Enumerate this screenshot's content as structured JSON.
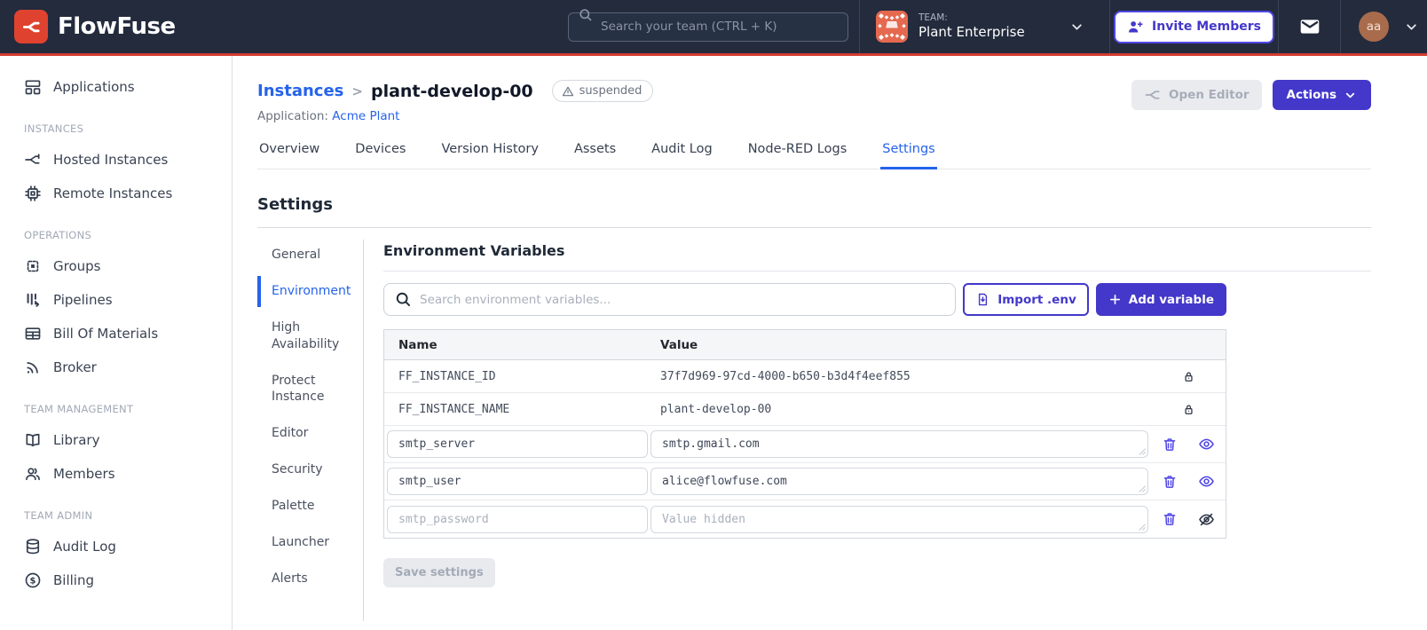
{
  "colors": {
    "navbar_bg": "#232B3D",
    "brand_red": "#DF432F",
    "red_accent_line": "#D23B31",
    "accent_indigo": "#4338CA",
    "link_blue": "#2563EB",
    "user_avatar_brown": "#A86B4C",
    "team_avatar_orange": "#E5694F"
  },
  "navbar": {
    "brand": "FlowFuse",
    "search_placeholder": "Search your team (CTRL + K)",
    "team_label": "TEAM:",
    "team_name": "Plant Enterprise",
    "invite_button": "Invite Members",
    "avatar_initials": "aa"
  },
  "sidebar": {
    "sections": [
      {
        "label": "",
        "items": [
          {
            "icon": "applications-icon",
            "label": "Applications"
          }
        ]
      },
      {
        "label": "INSTANCES",
        "items": [
          {
            "icon": "hosted-instances-icon",
            "label": "Hosted Instances"
          },
          {
            "icon": "remote-instances-icon",
            "label": "Remote Instances"
          }
        ]
      },
      {
        "label": "OPERATIONS",
        "items": [
          {
            "icon": "groups-icon",
            "label": "Groups"
          },
          {
            "icon": "pipelines-icon",
            "label": "Pipelines"
          },
          {
            "icon": "bill-of-materials-icon",
            "label": "Bill Of Materials"
          },
          {
            "icon": "broker-icon",
            "label": "Broker"
          }
        ]
      },
      {
        "label": "TEAM MANAGEMENT",
        "items": [
          {
            "icon": "library-icon",
            "label": "Library"
          },
          {
            "icon": "members-icon",
            "label": "Members"
          }
        ]
      },
      {
        "label": "TEAM ADMIN",
        "items": [
          {
            "icon": "audit-log-icon",
            "label": "Audit Log"
          },
          {
            "icon": "billing-icon",
            "label": "Billing"
          }
        ]
      }
    ]
  },
  "header": {
    "breadcrumb": "Instances",
    "separator": ">",
    "instance_name": "plant-develop-00",
    "status_badge": "suspended",
    "application_label": "Application:",
    "application_name": "Acme Plant",
    "open_editor_button": "Open Editor",
    "actions_button": "Actions"
  },
  "tabs": {
    "items": [
      "Overview",
      "Devices",
      "Version History",
      "Assets",
      "Audit Log",
      "Node-RED Logs",
      "Settings"
    ],
    "active": "Settings"
  },
  "settings": {
    "title": "Settings",
    "nav": {
      "items": [
        "General",
        "Environment",
        "High Availability",
        "Protect Instance",
        "Editor",
        "Security",
        "Palette",
        "Launcher",
        "Alerts"
      ],
      "active": "Environment"
    },
    "panel": {
      "title": "Environment Variables",
      "search_placeholder": "Search environment variables...",
      "import_button": "Import .env",
      "add_button": "Add variable",
      "table": {
        "columns": [
          "Name",
          "Value"
        ],
        "rows": [
          {
            "name": "FF_INSTANCE_ID",
            "value": "37f7d969-97cd-4000-b650-b3d4f4eef855",
            "locked": true
          },
          {
            "name": "FF_INSTANCE_NAME",
            "value": "plant-develop-00",
            "locked": true
          },
          {
            "name": "smtp_server",
            "value": "smtp.gmail.com",
            "locked": false,
            "value_visible": true
          },
          {
            "name": "smtp_user",
            "value": "alice@flowfuse.com",
            "locked": false,
            "value_visible": true
          },
          {
            "name": "smtp_password",
            "value": "",
            "value_placeholder": "Value hidden",
            "locked": false,
            "value_visible": false
          }
        ]
      },
      "save_button": "Save settings"
    }
  }
}
